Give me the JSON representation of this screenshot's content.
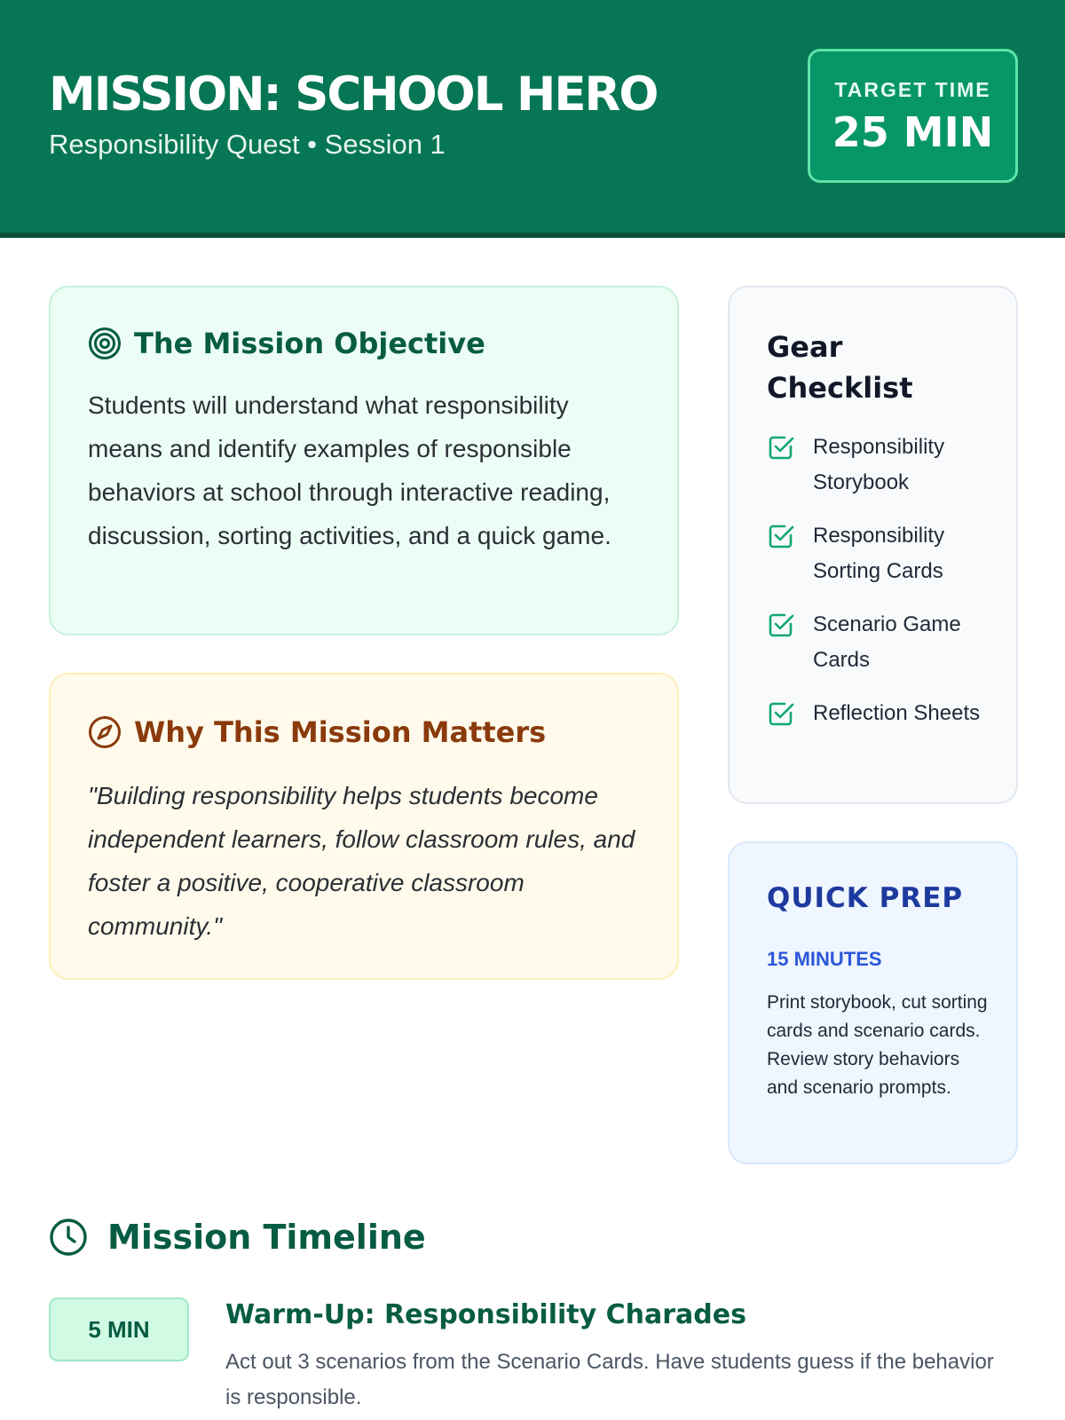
{
  "header": {
    "title": "MISSION: SCHOOL HERO",
    "subtitle": "Responsibility Quest • Session 1",
    "target_label": "TARGET TIME",
    "target_value": "25 MIN"
  },
  "objective": {
    "icon": "target-icon",
    "title": "The Mission Objective",
    "text": "Students will understand what responsibility means and identify examples of responsible behaviors at school through interactive reading, discussion, sorting activities, and a quick game."
  },
  "why": {
    "icon": "compass-icon",
    "title": "Why This Mission Matters",
    "quote": "\"Building responsibility helps students become independent learners, follow classroom rules, and foster a positive, cooperative classroom community.\""
  },
  "gear": {
    "title": "Gear Checklist",
    "items": [
      "Responsibility Storybook",
      "Responsibility Sorting Cards",
      "Scenario Game Cards",
      "Reflection Sheets"
    ]
  },
  "prep": {
    "title": "QUICK PREP",
    "duration": "15 MINUTES",
    "text": "Print storybook, cut sorting cards and scenario cards. Review story behaviors and scenario prompts."
  },
  "timeline": {
    "icon": "clock-icon",
    "title": "Mission Timeline",
    "items": [
      {
        "duration": "5 MIN",
        "title": "Warm-Up: Responsibility Charades",
        "description": "Act out 3 scenarios from the Scenario Cards. Have students guess if the behavior is responsible."
      }
    ]
  },
  "colors": {
    "header_bg": "#077654",
    "accent_green": "#075c43",
    "accent_amber": "#8a3a0b",
    "accent_blue": "#1e3a9e"
  }
}
